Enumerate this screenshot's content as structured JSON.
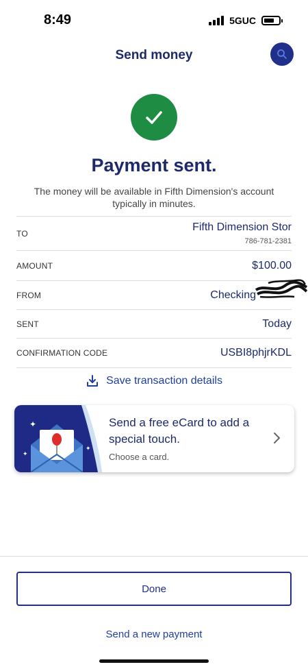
{
  "status_bar": {
    "time": "8:49",
    "network": "5GUC",
    "battery_level": 0.7
  },
  "header": {
    "title": "Send money",
    "search_icon": "search-icon"
  },
  "confirmation": {
    "icon": "check-icon",
    "heading": "Payment sent.",
    "subtext": "The money will be available in Fifth Dimension's account typically in minutes."
  },
  "details": [
    {
      "label": "TO",
      "value": "Fifth Dimension Stor",
      "sub": "786-781-2381"
    },
    {
      "label": "AMOUNT",
      "value": "$100.00"
    },
    {
      "label": "FROM",
      "value": "Checking"
    },
    {
      "label": "SENT",
      "value": "Today"
    },
    {
      "label": "CONFIRMATION CODE",
      "value": "USBI8phjrKDL"
    }
  ],
  "save_link": {
    "label": "Save transaction details",
    "icon": "download-icon"
  },
  "ecard": {
    "title": "Send a free eCard to add a special touch.",
    "subtitle": "Choose a card.",
    "icon": "envelope-icon"
  },
  "actions": {
    "done_label": "Done",
    "new_payment_label": "Send a new payment"
  },
  "colors": {
    "brand_navy": "#1c2a6b",
    "button_blue": "#1f2f8a",
    "success_green": "#1e8c43",
    "link_blue": "#1f3ea0"
  }
}
